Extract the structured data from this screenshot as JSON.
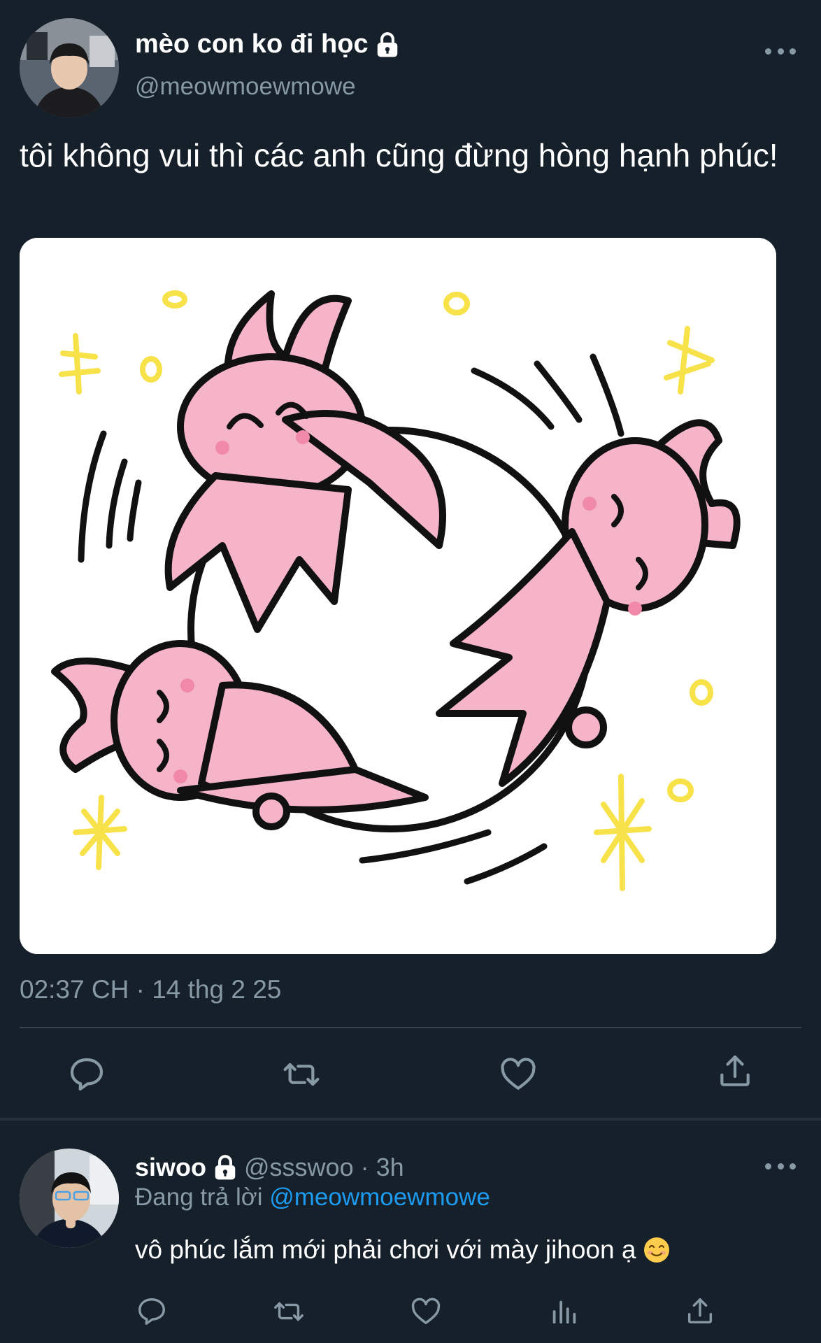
{
  "tweet": {
    "display_name": "mèo con ko đi học",
    "handle": "@meowmoewmowe",
    "text": "tôi không vui thì các anh cũng đừng hòng hạnh phúc!",
    "timestamp": "02:37 CH · 14 thg 2 25",
    "avatar_icon": "user-avatar",
    "locked_icon": "lock-icon",
    "media_icon": "pink-bunnies-illustration"
  },
  "reply": {
    "display_name": "siwoo",
    "handle_time": "@ssswoo · 3h",
    "replying_prefix": "Đang trả lời",
    "replying_mention": "@meowmoewmowe",
    "text": "vô phúc lắm mới phải chơi với mày jihoon ạ",
    "emoji": "smiling-face-emoji"
  },
  "colors": {
    "background": "#15202b",
    "text_primary": "#ffffff",
    "text_secondary": "#8899a6",
    "link": "#1d9bf0",
    "divider": "#38444d"
  }
}
